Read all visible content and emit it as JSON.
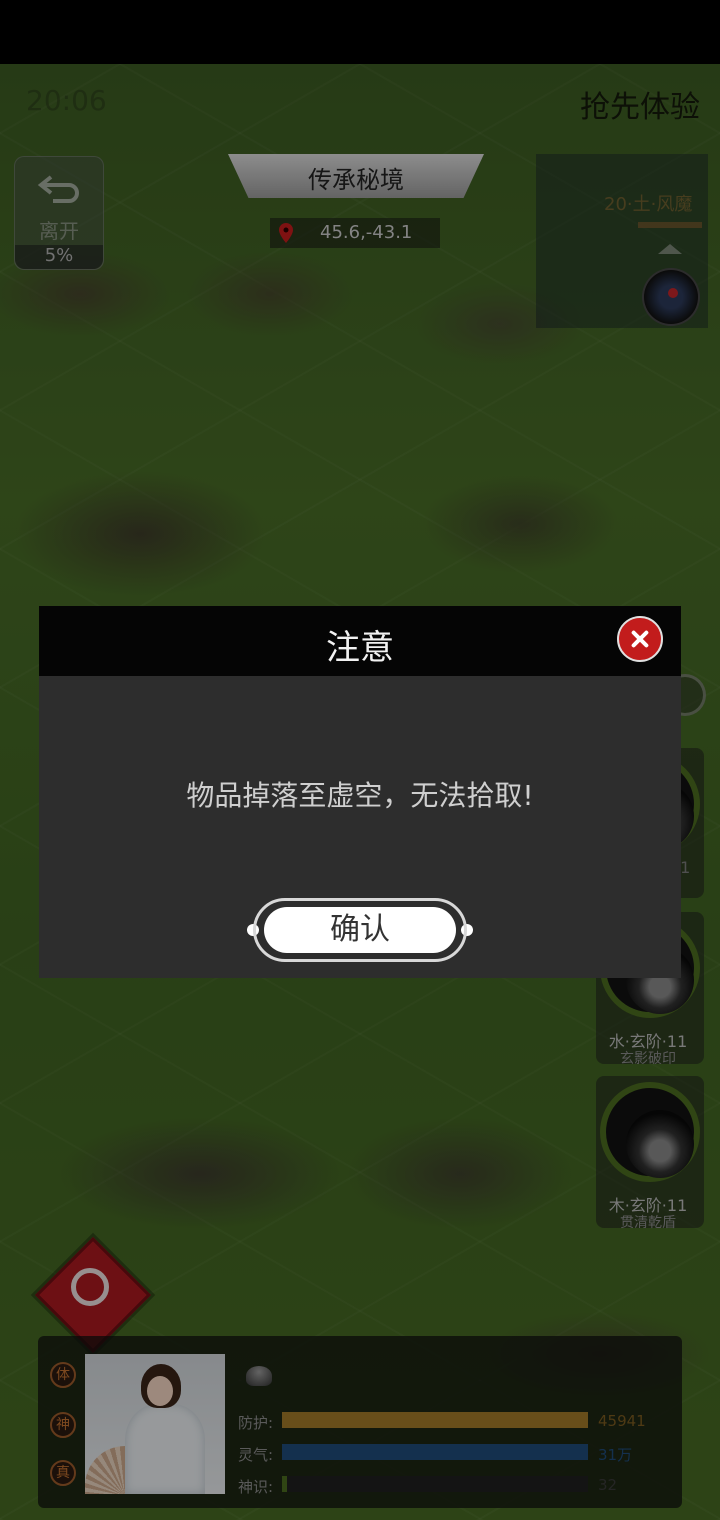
{
  "hud": {
    "clock": "20:06",
    "promo": "抢先体验",
    "leave": {
      "label": "离开",
      "percent": "5%"
    },
    "zone_title": "传承秘境",
    "coords": "45.6,-43.1",
    "minimap": {
      "label": "20·土·风魔"
    }
  },
  "skills": [
    {
      "number": "11"
    },
    {
      "grade": "水·玄阶·11",
      "name": "玄影破印"
    },
    {
      "grade": "木·玄阶·11",
      "name": "贯清乾盾"
    }
  ],
  "player": {
    "badges": [
      "体",
      "神",
      "真"
    ],
    "stats": [
      {
        "label": "防护:",
        "value": "45941",
        "fill": 1.0,
        "color": "#a07829",
        "value_color": "#7a5a20"
      },
      {
        "label": "灵气:",
        "value": "31万",
        "fill": 1.0,
        "color": "#1f4a78",
        "value_color": "#1f4a78"
      },
      {
        "label": "神识:",
        "value": "32",
        "fill": 0.01,
        "color": "#4a6a20",
        "value_color": "#3a3a3a"
      }
    ]
  },
  "dialog": {
    "title": "注意",
    "message": "物品掉落至虚空，无法拾取!",
    "confirm_label": "确认"
  }
}
